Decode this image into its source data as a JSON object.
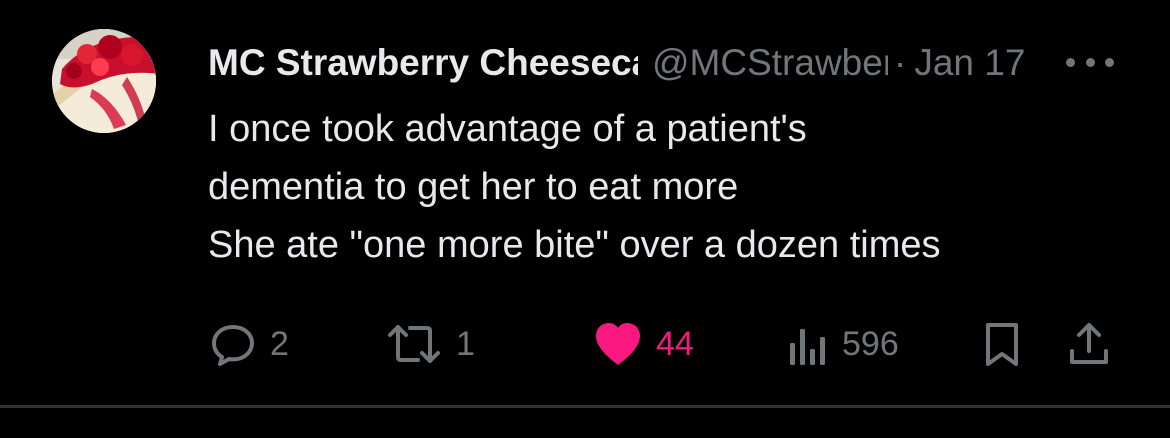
{
  "tweet": {
    "author": {
      "display_name": "MC Strawberry Cheesecake",
      "handle": "@MCStrawberryCheesecake",
      "avatar_icon": "strawberry-cheesecake-avatar"
    },
    "separator": "·",
    "date": "Jan 17",
    "more_icon": "more-horizontal-icon",
    "text_lines": [
      "I once took advantage of a patient's",
      "dementia to get her to eat more",
      "She ate \"one more bite\" over a dozen times"
    ],
    "actions": {
      "replies": "2",
      "reposts": "1",
      "likes": "44",
      "views": "596"
    },
    "colors": {
      "background": "#000000",
      "text": "#e7e9ea",
      "muted": "#71767b",
      "like": "#f91880",
      "divider": "#2f3336"
    }
  }
}
